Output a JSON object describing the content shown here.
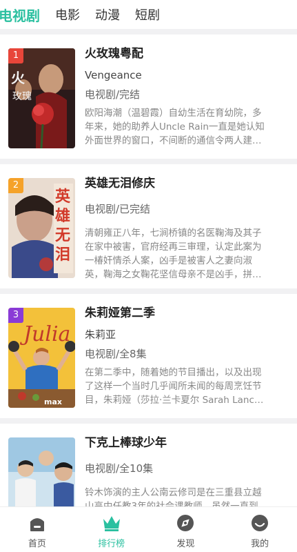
{
  "top_tabs": [
    "电视剧",
    "电影",
    "动漫",
    "短剧"
  ],
  "colors": {
    "accent": "#2bc0a0",
    "rank1": "#e8463a",
    "rank2": "#f5a22a",
    "rank3": "#8a3bd6"
  },
  "items": [
    {
      "rank": "1",
      "title": "火玫瑰粤配",
      "subtitle": "Vengeance",
      "meta": "电视剧/完结",
      "desc": "欧阳海潮（温碧霞）自幼生活在育幼院，多\n年来，她的助养人Uncle Rain一直是她认知\n外面世界的窗口，不间断的通信令两人建…"
    },
    {
      "rank": "2",
      "title": "英雄无泪修庆",
      "subtitle": "",
      "meta": "电视剧/已完结",
      "desc": "清朝雍正八年，七涧桥镇的名医鞠海及其子\n在家中被害，官府经再三审理，认定此案为\n一椿奸情杀人案，凶手是被害人之妻向淑\n英，鞠海之女鞠花坚信母亲不是凶手，拼…"
    },
    {
      "rank": "3",
      "title": "朱莉娅第二季",
      "subtitle": "朱莉亚",
      "meta": "电视剧/全8集",
      "desc": "在第二季中，随着她的节目播出，以及出现\n了这样一个当时几乎闻所未闻的每周烹饪节\n目，朱莉娅（莎拉·兰卡夏尔 Sarah Lanc…"
    },
    {
      "rank": "",
      "title": "下克上棒球少年",
      "subtitle": "",
      "meta": "电视剧/全10集",
      "desc": "铃木饰演的主人公南云修司是在三重县立越\n山高中任教3年的社会课教师。虽然一直到"
    }
  ],
  "bottom_nav": [
    {
      "label": "首页",
      "icon": "home-icon"
    },
    {
      "label": "排行榜",
      "icon": "crown-icon"
    },
    {
      "label": "发现",
      "icon": "discover-icon"
    },
    {
      "label": "我的",
      "icon": "profile-icon"
    }
  ]
}
